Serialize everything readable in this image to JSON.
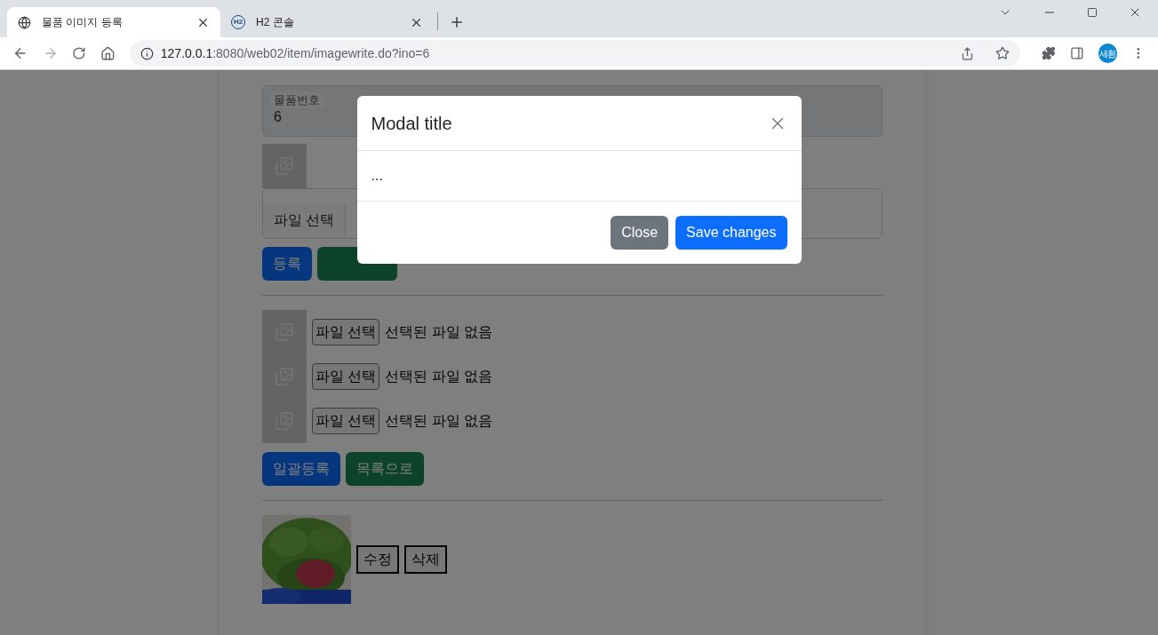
{
  "browser": {
    "tabs": [
      {
        "title": "물품 이미지 등록",
        "selected": true,
        "kind": "globe"
      },
      {
        "title": "H2 콘솔",
        "selected": false,
        "kind": "logo",
        "logo_text": "H2"
      }
    ],
    "url_host": "127.0.0.1",
    "url_path": ":8080/web02/item/imagewrite.do?ino=6",
    "profile": "세환"
  },
  "form": {
    "field_label": "물품번호",
    "field_value": "6",
    "file_button": "파일 선택",
    "buttons": [
      {
        "label": "등록",
        "kind": "primary"
      },
      {
        "kind": "success"
      }
    ]
  },
  "multi_upload": {
    "rows": [
      {
        "button": "파일 선택",
        "status": "선택된 파일 없음"
      },
      {
        "button": "파일 선택",
        "status": "선택된 파일 없음"
      },
      {
        "button": "파일 선택",
        "status": "선택된 파일 없음"
      }
    ],
    "buttons": [
      {
        "label": "일괄등록",
        "kind": "primary"
      },
      {
        "label": "목록으로",
        "kind": "success"
      }
    ]
  },
  "existing_image": {
    "kind": "picture",
    "buttons": [
      "수정",
      "삭제"
    ]
  },
  "modal": {
    "title": "Modal title",
    "body": "...",
    "buttons": [
      {
        "label": "Close",
        "kind": "secondary"
      },
      {
        "label": "Save changes",
        "kind": "primary"
      }
    ]
  }
}
